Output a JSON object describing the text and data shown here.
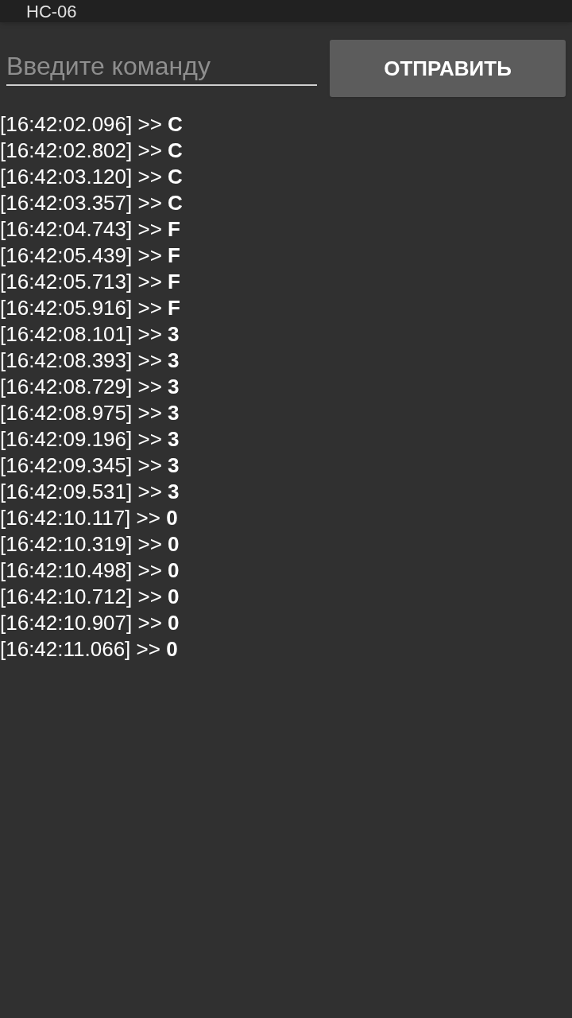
{
  "window": {
    "title": "HC-06"
  },
  "command": {
    "placeholder": "Введите команду"
  },
  "send_button": "ОТПРАВИТЬ",
  "log": [
    "[16:42:02.096] >> **C**",
    "[16:42:02.802] >> **C**",
    "[16:42:03.120] >> **C**",
    "[16:42:03.357] >> **C**",
    "[16:42:04.743] >> **F**",
    "[16:42:05.439] >> **F**",
    "[16:42:05.713] >> **F**",
    "[16:42:05.916] >> **F**",
    "[16:42:08.101] >> **3**",
    "[16:42:08.393] >> **3**",
    "[16:42:08.729] >> **3**",
    "[16:42:08.975] >> **3**",
    "[16:42:09.196] >> **3**",
    "[16:42:09.345] >> **3**",
    "[16:42:09.531] >> **3**",
    "[16:42:10.117] >> **0**",
    "[16:42:10.319] >> **0**",
    "[16:42:10.498] >> **0**",
    "[16:42:10.712] >> **0**",
    "[16:42:10.907] >> **0**",
    "[16:42:11.066] >> **0**"
  ]
}
